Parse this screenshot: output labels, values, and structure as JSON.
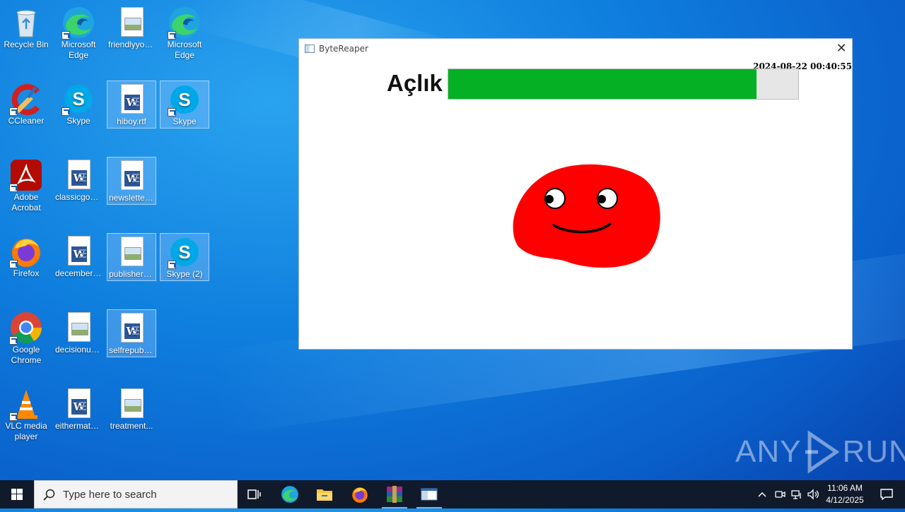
{
  "desktop": {
    "icons": [
      {
        "label": "Recycle Bin"
      },
      {
        "label": "Microsoft Edge"
      },
      {
        "label": "friendlyyou..."
      },
      {
        "label": "Microsoft Edge"
      },
      {
        "label": "CCleaner"
      },
      {
        "label": "Skype"
      },
      {
        "label": "hiboy.rtf"
      },
      {
        "label": "Skype"
      },
      {
        "label": "Adobe Acrobat"
      },
      {
        "label": "classicgoo..."
      },
      {
        "label": "newsletter..."
      },
      {
        "label": "Firefox"
      },
      {
        "label": "decemberu..."
      },
      {
        "label": "publishera..."
      },
      {
        "label": "Skype (2)"
      },
      {
        "label": "Google Chrome"
      },
      {
        "label": "decisionuni..."
      },
      {
        "label": "selfrepubli..."
      },
      {
        "label": "VLC media player"
      },
      {
        "label": "eithermatur..."
      },
      {
        "label": "treatment..."
      }
    ]
  },
  "window": {
    "title": "ByteReaper",
    "close_glyph": "✕",
    "timestamp": "2024-08-22 00:40:55",
    "hunger_label": "Açlık",
    "hunger_level": 0.88,
    "colors": {
      "bar_fill": "#06b025",
      "bar_track": "#e6e6e6",
      "pet": "#ff0000"
    }
  },
  "watermark": {
    "left": "ANY",
    "right": "RUN"
  },
  "taskbar": {
    "search_placeholder": "Type here to search",
    "time": "11:06 AM",
    "date": "4/12/2025"
  }
}
